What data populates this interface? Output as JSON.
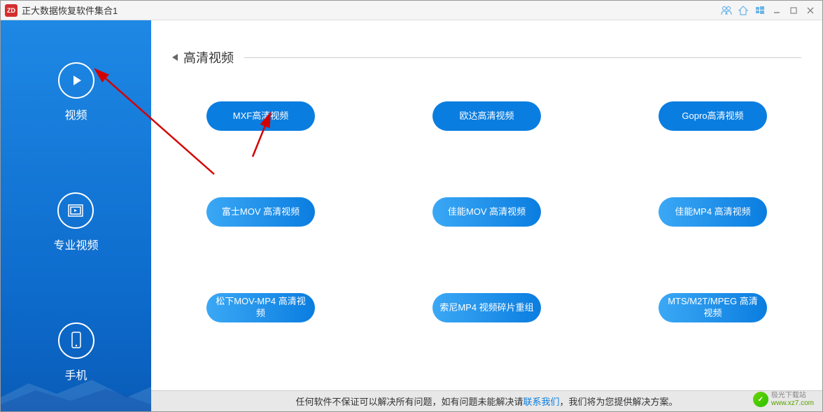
{
  "titlebar": {
    "app_icon_text": "ZD",
    "title": "正大数据恢复软件集合1"
  },
  "sidebar": {
    "items": [
      {
        "label": "视频",
        "icon": "play"
      },
      {
        "label": "专业视频",
        "icon": "film"
      },
      {
        "label": "手机",
        "icon": "phone"
      }
    ]
  },
  "section": {
    "title": "高清视频"
  },
  "buttons": [
    {
      "label": "MXF高清视频"
    },
    {
      "label": "欧达高清视频"
    },
    {
      "label": "Gopro高清视频"
    },
    {
      "label": "富士MOV 高清视频"
    },
    {
      "label": "佳能MOV 高清视频"
    },
    {
      "label": "佳能MP4 高清视频"
    },
    {
      "label": "松下MOV-MP4 高清视频"
    },
    {
      "label": "索尼MP4 视频碎片重组"
    },
    {
      "label": "MTS/M2T/MPEG 高清视频"
    }
  ],
  "footer": {
    "text_before": "任何软件不保证可以解决所有问题，如有问题未能解决请 ",
    "link": "联系我们",
    "text_after": "，我们将为您提供解决方案。"
  },
  "watermark": {
    "line1": "极光下载站",
    "line2": "www.xz7.com"
  }
}
